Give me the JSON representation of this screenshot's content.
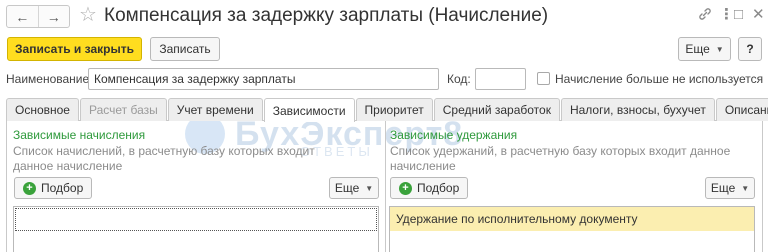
{
  "window": {
    "title": "Компенсация за задержку зарплаты (Начисление)",
    "nav_back_icon": "←",
    "nav_forward_icon": "→",
    "star_icon": "☆",
    "link_icon": "🔗",
    "menu_icon": "⋮",
    "maximize_icon": "□",
    "close_icon": "✕"
  },
  "toolbar": {
    "save_close_label": "Записать и закрыть",
    "save_label": "Записать",
    "more_label": "Еще",
    "help_label": "?"
  },
  "form": {
    "name_label": "Наименование:",
    "name_value": "Компенсация за задержку зарплаты",
    "code_label": "Код:",
    "code_value": "",
    "unused_label": "Начисление больше не используется",
    "unused_checked": false
  },
  "tabs": [
    {
      "label": "Основное",
      "state": "normal"
    },
    {
      "label": "Расчет базы",
      "state": "disabled"
    },
    {
      "label": "Учет времени",
      "state": "normal"
    },
    {
      "label": "Зависимости",
      "state": "active"
    },
    {
      "label": "Приоритет",
      "state": "normal"
    },
    {
      "label": "Средний заработок",
      "state": "normal"
    },
    {
      "label": "Налоги, взносы, бухучет",
      "state": "normal"
    },
    {
      "label": "Описание",
      "state": "normal"
    }
  ],
  "left_panel": {
    "title": "Зависимые начисления",
    "description": "Список начислений, в расчетную базу которых входит данное начисление",
    "pick_label": "Подбор",
    "more_label": "Еще",
    "rows": []
  },
  "right_panel": {
    "title": "Зависимые удержания",
    "description": "Список удержаний, в расчетную базу которых входит данное начисление",
    "pick_label": "Подбор",
    "more_label": "Еще",
    "rows": [
      "Удержание по исполнительному документу"
    ]
  },
  "watermark": {
    "text": "БухЭксперт8",
    "sub": "ОТВЕТЫ"
  },
  "colors": {
    "primary_button": "#ffdd1f",
    "panel_title": "#2f9a3c",
    "selected_row": "#fbeeb0"
  }
}
